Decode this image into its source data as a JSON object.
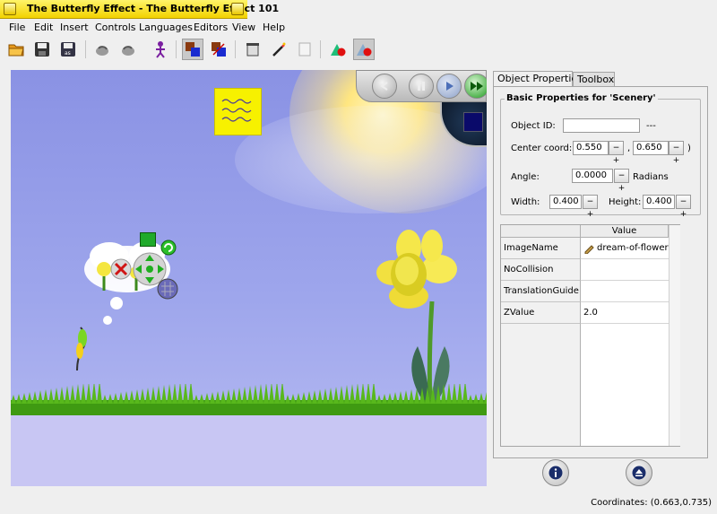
{
  "window": {
    "title": "The Butterfly Effect - The Butterfly Effect 101"
  },
  "menu": [
    "File",
    "Edit",
    "Insert",
    "Controls",
    "Languages",
    "Editors",
    "View",
    "Help"
  ],
  "toolbar": {
    "icons": [
      "open-icon",
      "save-icon",
      "save-as-icon",
      "undo-icon",
      "redo-icon",
      "drag-icon",
      "move-mode-icon",
      "resize-mode-icon",
      "delete-icon",
      "wand-icon",
      "properties-icon",
      "grid-icon",
      "collision-icon"
    ]
  },
  "properties": {
    "tabs": [
      "Object Properties",
      "Toolbox"
    ],
    "group_title": "Basic Properties for 'Scenery'",
    "object_id_label": "Object ID:",
    "object_id_value": "",
    "object_id_suffix": "---",
    "center_label": "Center coord: (",
    "center_x": "0.550",
    "center_sep": ",",
    "center_y": "0.650",
    "center_close": ")",
    "angle_label": "Angle:",
    "angle_value": "0.0000",
    "angle_unit": "Radians",
    "width_label": "Width:",
    "width_value": "0.400",
    "height_label": "Height:",
    "height_value": "0.400",
    "stepper_label": "−+"
  },
  "table": {
    "header": "Value",
    "rows": [
      {
        "name": "ImageName",
        "value": "dream-of-flowers"
      },
      {
        "name": "NoCollision",
        "value": ""
      },
      {
        "name": "TranslationGuide",
        "value": ""
      },
      {
        "name": "ZValue",
        "value": "2.0"
      }
    ]
  },
  "status": {
    "coordinates": "Coordinates: (0.663,0.735)"
  },
  "colors": {
    "title_yellow": "#f2d200",
    "sky": "#9ea6ec",
    "grass": "#3f9a12",
    "flower": "#f3e43a"
  }
}
